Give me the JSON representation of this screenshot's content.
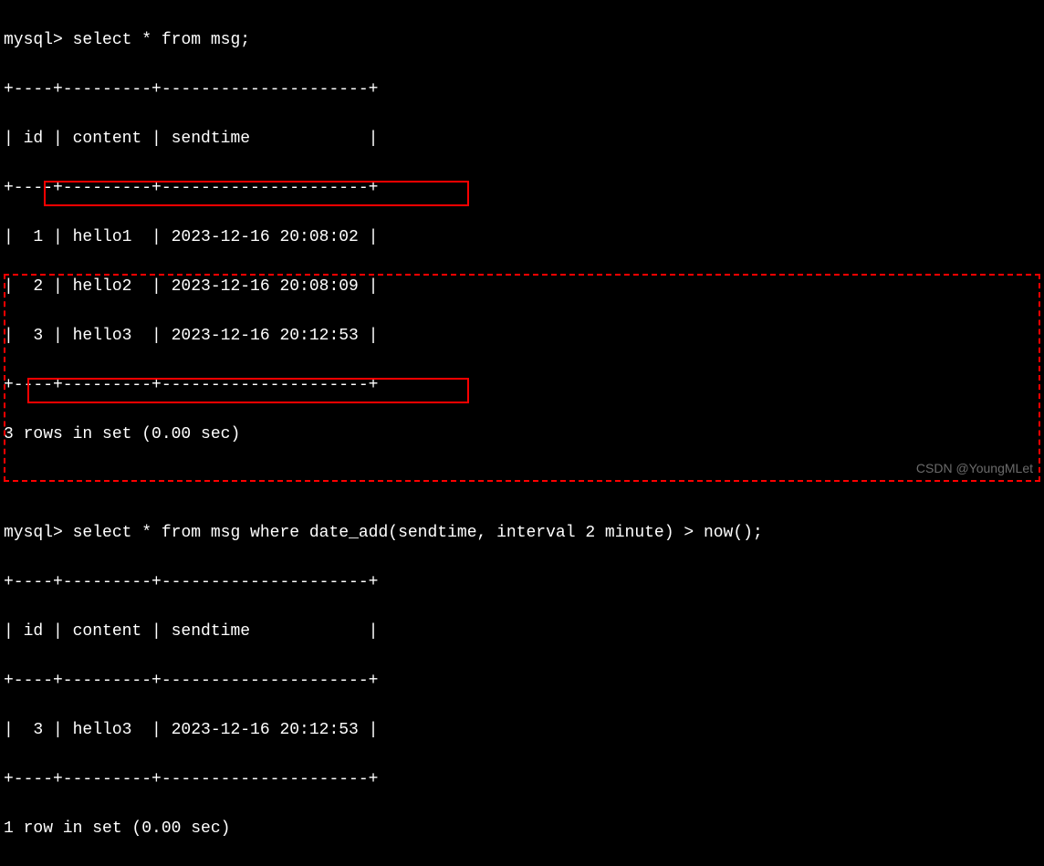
{
  "prompt": "mysql>",
  "query1": {
    "command": "select * from msg;",
    "border_top": "+----+---------+---------------------+",
    "border_mid": "+----+---------+---------------------+",
    "border_bot": "+----+---------+---------------------+",
    "header": "| id | content | sendtime            |",
    "rows": [
      "|  1 | hello1  | 2023-12-16 20:08:02 |",
      "|  2 | hello2  | 2023-12-16 20:08:09 |",
      "|  3 | hello3  | 2023-12-16 20:12:53 |"
    ],
    "result": "3 rows in set (0.00 sec)"
  },
  "query2": {
    "command": "select * from msg where date_add(sendtime, interval 2 minute) > now();",
    "border_top": "+----+---------+---------------------+",
    "border_mid": "+----+---------+---------------------+",
    "border_bot": "+----+---------+---------------------+",
    "header": "| id | content | sendtime            |",
    "rows": [
      "|  3 | hello3  | 2023-12-16 20:12:53 |"
    ],
    "result": "1 row in set (0.00 sec)"
  },
  "watermark": "CSDN @YoungMLet",
  "chart_data": {
    "type": "table",
    "query1": {
      "columns": [
        "id",
        "content",
        "sendtime"
      ],
      "rows": [
        {
          "id": 1,
          "content": "hello1",
          "sendtime": "2023-12-16 20:08:02"
        },
        {
          "id": 2,
          "content": "hello2",
          "sendtime": "2023-12-16 20:08:09"
        },
        {
          "id": 3,
          "content": "hello3",
          "sendtime": "2023-12-16 20:12:53"
        }
      ]
    },
    "query2": {
      "columns": [
        "id",
        "content",
        "sendtime"
      ],
      "rows": [
        {
          "id": 3,
          "content": "hello3",
          "sendtime": "2023-12-16 20:12:53"
        }
      ]
    }
  }
}
